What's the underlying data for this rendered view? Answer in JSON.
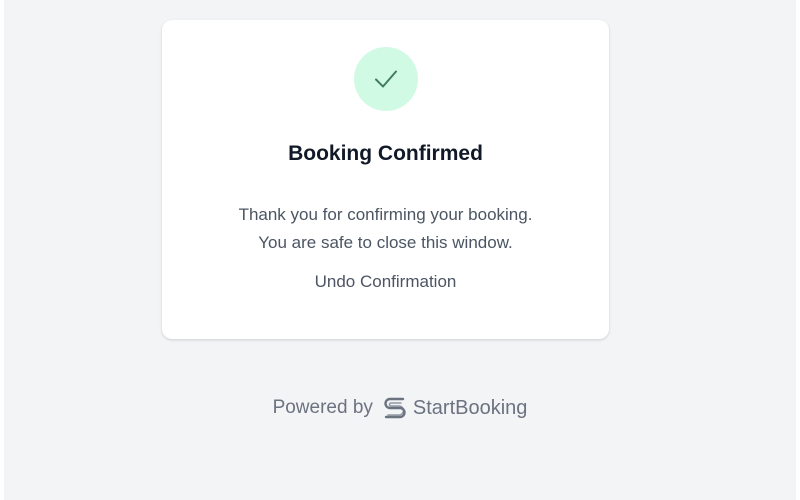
{
  "card": {
    "icon": "checkmark-icon",
    "title": "Booking Confirmed",
    "message_line1": "Thank you for confirming your booking.",
    "message_line2": "You are safe to close this window.",
    "undo_label": "Undo Confirmation"
  },
  "footer": {
    "powered_by": "Powered by",
    "brand_icon": "startbooking-logo-icon",
    "brand_name": "StartBooking"
  },
  "colors": {
    "page_background": "#f3f4f6",
    "card_background": "#ffffff",
    "badge_background": "#d1fae5",
    "check_color": "#3f7d5c",
    "title_color": "#111827",
    "text_color": "#4b5563",
    "footer_color": "#6b7280"
  }
}
